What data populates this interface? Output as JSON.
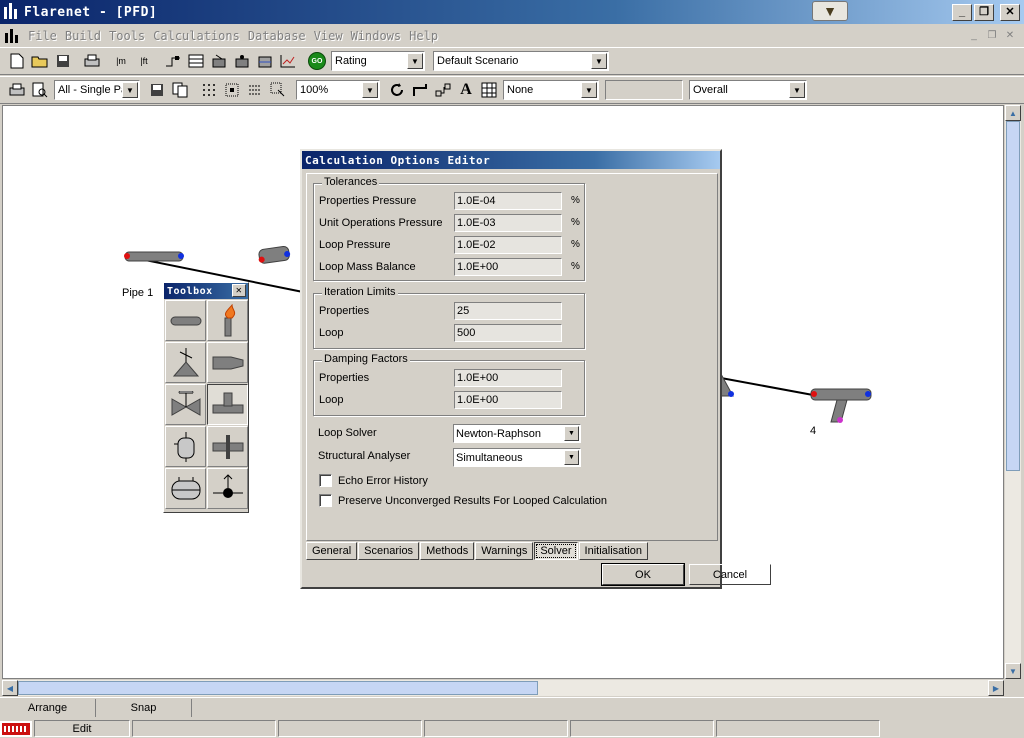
{
  "window": {
    "title": "Flarenet - [PFD]"
  },
  "menu": {
    "items": [
      {
        "id": "file",
        "label": "File",
        "accel": "F"
      },
      {
        "id": "build",
        "label": "Build",
        "accel": "B"
      },
      {
        "id": "tools",
        "label": "Tools",
        "accel": "T"
      },
      {
        "id": "calculations",
        "label": "Calculations",
        "accel": "C"
      },
      {
        "id": "database",
        "label": "Database",
        "accel": "D"
      },
      {
        "id": "view",
        "label": "View",
        "accel": "V"
      },
      {
        "id": "windows",
        "label": "Windows",
        "accel": "W"
      },
      {
        "id": "help",
        "label": "Help",
        "accel": "H"
      }
    ]
  },
  "toolbar1": {
    "unit_m": "m",
    "unit_ft": "ft",
    "go_label": "GO",
    "mode_value": "Rating",
    "scenario_value": "Default Scenario"
  },
  "toolbar2": {
    "page_value": "All - Single Pa",
    "zoom_value": "100%",
    "text_tool": "A",
    "filter_value": "None",
    "empty_value": "",
    "overall_value": "Overall"
  },
  "canvas": {
    "pipe1_label": "Pipe 1",
    "node4_label": "4"
  },
  "toolbox": {
    "title": "Toolbox"
  },
  "dialog": {
    "title": "Calculation Options Editor",
    "tolerances": {
      "label": "Tolerances",
      "rows": [
        {
          "label": "Properties Pressure",
          "value": "1.0E-04",
          "unit": "%"
        },
        {
          "label": "Unit Operations Pressure",
          "value": "1.0E-03",
          "unit": "%"
        },
        {
          "label": "Loop Pressure",
          "value": "1.0E-02",
          "unit": "%"
        },
        {
          "label": "Loop Mass Balance",
          "value": "1.0E+00",
          "unit": "%"
        }
      ]
    },
    "iteration": {
      "label": "Iteration Limits",
      "rows": [
        {
          "label": "Properties",
          "value": "25"
        },
        {
          "label": "Loop",
          "value": "500"
        }
      ]
    },
    "damping": {
      "label": "Damping Factors",
      "rows": [
        {
          "label": "Properties",
          "value": "1.0E+00"
        },
        {
          "label": "Loop",
          "value": "1.0E+00"
        }
      ]
    },
    "loop_solver": {
      "label": "Loop Solver",
      "value": "Newton-Raphson"
    },
    "structural_analyser": {
      "label": "Structural Analyser",
      "value": "Simultaneous"
    },
    "echo_error": {
      "label": "Echo Error History",
      "checked": false
    },
    "preserve": {
      "label": "Preserve Unconverged Results For Looped Calculation",
      "checked": false
    },
    "tabs": [
      {
        "id": "general",
        "label": "General"
      },
      {
        "id": "scenarios",
        "label": "Scenarios"
      },
      {
        "id": "methods",
        "label": "Methods"
      },
      {
        "id": "warnings",
        "label": "Warnings"
      },
      {
        "id": "solver",
        "label": "Solver",
        "active": true
      },
      {
        "id": "initialisation",
        "label": "Initialisation"
      }
    ],
    "ok_label": "OK",
    "cancel_label": "Cancel"
  },
  "bottom_tabs": {
    "arrange": "Arrange",
    "snap": "Snap"
  },
  "status": {
    "mode": "Edit"
  },
  "colors": {
    "pipe": "#7f7f7f",
    "inlet": "#e01010",
    "outlet": "#1030e0",
    "title_bar": "#0a246a"
  }
}
